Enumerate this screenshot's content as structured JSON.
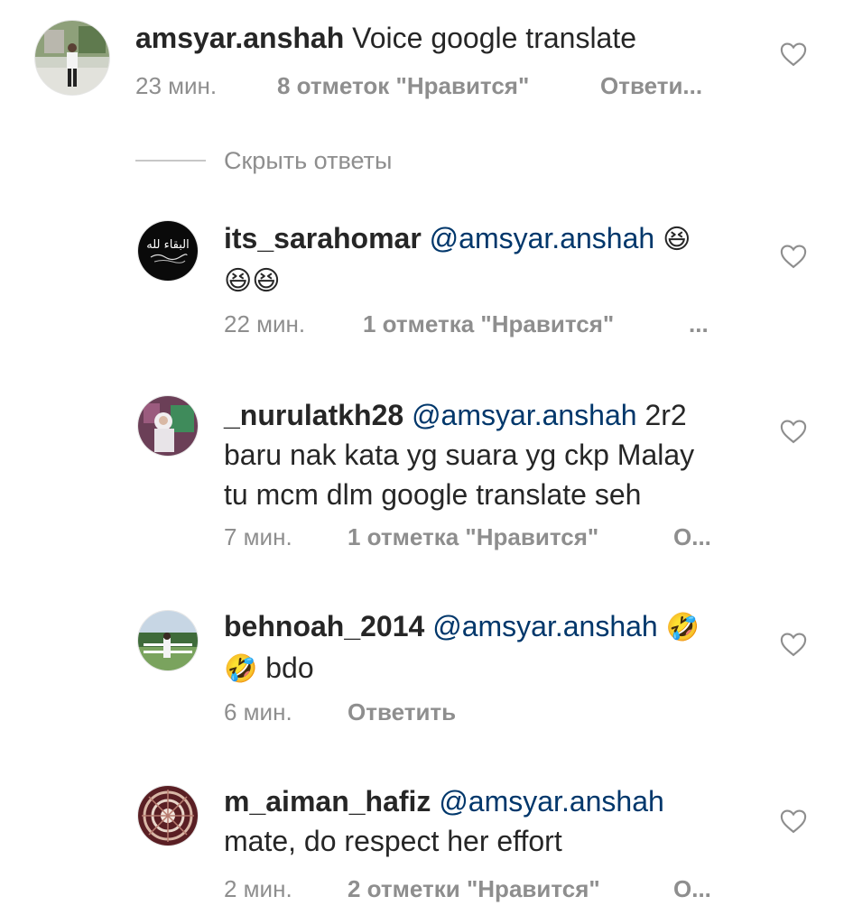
{
  "main_comment": {
    "username": "amsyar.anshah",
    "text": "Voice google translate",
    "time": "23 мин.",
    "likes": "8 отметок \"Нравится\"",
    "reply": "Ответи..."
  },
  "hide_replies_label": "Скрыть ответы",
  "replies": [
    {
      "username": "its_sarahomar",
      "mention": "@amsyar.anshah",
      "emoji_a": "😆",
      "emoji_b": "😆😆",
      "time": "22 мин.",
      "likes": "1 отметка \"Нравится\"",
      "more": "..."
    },
    {
      "username": "_nurulatkh28",
      "mention": "@amsyar.anshah",
      "text_a": "2r2",
      "text_b": "baru nak kata yg suara yg ckp Malay",
      "text_c": "tu mcm dlm google translate seh",
      "time": "7 мин.",
      "likes": "1 отметка \"Нравится\"",
      "more": "О..."
    },
    {
      "username": "behnoah_2014",
      "mention": "@amsyar.anshah",
      "emoji_a": "🤣",
      "emoji_b": "🤣",
      "text_b": "bdo",
      "time": "6 мин.",
      "reply": "Ответить"
    },
    {
      "username": "m_aiman_hafiz",
      "mention": "@amsyar.anshah",
      "text_b": "mate, do respect her effort",
      "time": "2 мин.",
      "likes": "2 отметки \"Нравится\"",
      "more": "О..."
    }
  ],
  "colors": {
    "text": "#262626",
    "mention": "#00376b",
    "secondary": "#8e8e8e"
  }
}
